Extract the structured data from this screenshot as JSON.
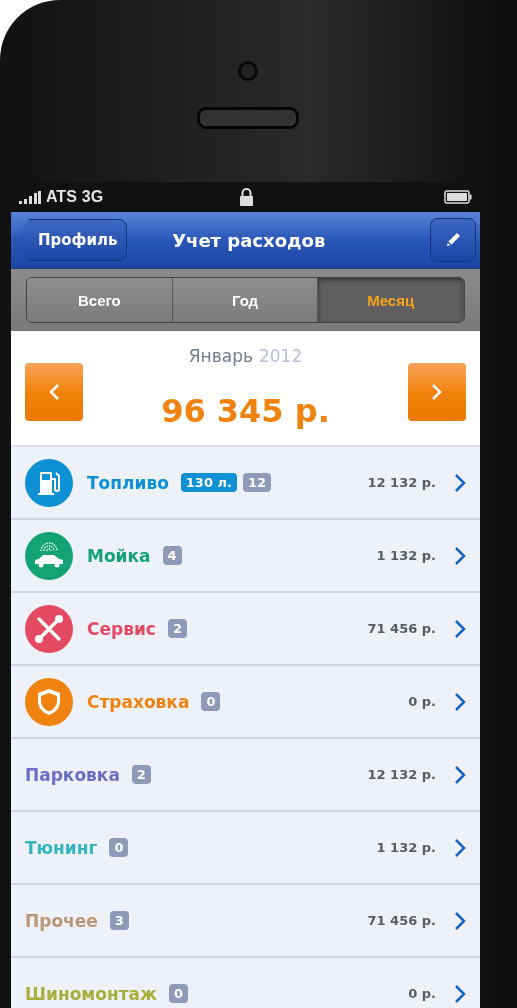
{
  "status_bar": {
    "carrier": "ATS",
    "network": "3G"
  },
  "nav_bar": {
    "back": "Профиль",
    "title": "Учет расходов"
  },
  "tabs": [
    {
      "label": "Всего",
      "selected": false
    },
    {
      "label": "Год",
      "selected": false
    },
    {
      "label": "Месяц",
      "selected": true
    }
  ],
  "period": {
    "month": "Январь",
    "year": "2012",
    "total": "96 345 р."
  },
  "categories": [
    {
      "kind": "fuel",
      "name": "Топливо",
      "color": "#0e90d4",
      "volume": "130 л.",
      "count": "12",
      "amount": "12 132 р."
    },
    {
      "kind": "wash",
      "name": "Мойка",
      "color": "#13a374",
      "count": "4",
      "amount": "1 132 р."
    },
    {
      "kind": "service",
      "name": "Сервис",
      "color": "#e54a63",
      "count": "2",
      "amount": "71 456 р."
    },
    {
      "kind": "insurance",
      "name": "Страховка",
      "color": "#f0820f",
      "count": "0",
      "amount": "0 р."
    },
    {
      "kind": "plain",
      "name": "Парковка",
      "color": "#6a6fc4",
      "count": "2",
      "amount": "12 132 р."
    },
    {
      "kind": "plain",
      "name": "Тюнинг",
      "color": "#34b5c0",
      "count": "0",
      "amount": "1 132 р."
    },
    {
      "kind": "plain",
      "name": "Прочее",
      "color": "#b89878",
      "count": "3",
      "amount": "71 456 р."
    },
    {
      "kind": "plain",
      "name": "Шиномонтаж",
      "color": "#a8ae3a",
      "count": "0",
      "amount": "0 р."
    }
  ]
}
